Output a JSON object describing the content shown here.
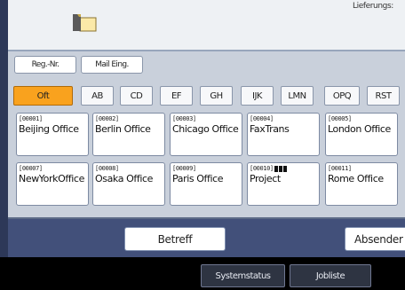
{
  "header": {
    "folder_label": "Lieferungs:"
  },
  "buttons": {
    "reg_nr": "Reg.-Nr.",
    "mail_eing": "Mail Eing."
  },
  "tabs": [
    "Oft",
    "AB",
    "CD",
    "EF",
    "GH",
    "IJK",
    "LMN",
    "OPQ",
    "RST"
  ],
  "active_tab": "Oft",
  "destinations": [
    {
      "number": "[00001]",
      "name": "Beijing Office"
    },
    {
      "number": "[00002]",
      "name": "Berlin Office"
    },
    {
      "number": "[00003]",
      "name": "Chicago Office"
    },
    {
      "number": "[00004]",
      "name": "FaxTrans"
    },
    {
      "number": "[00005]",
      "name": "London Office"
    },
    {
      "number": "[00007]",
      "name": "NewYorkOffice"
    },
    {
      "number": "[00008]",
      "name": "Osaka Office"
    },
    {
      "number": "[00009]",
      "name": "Paris Office"
    },
    {
      "number": "[00010]",
      "name": "Project",
      "group_icon": "group-icon"
    },
    {
      "number": "[00011]",
      "name": "Rome Office"
    }
  ],
  "actions": {
    "betreff": "Betreff",
    "absender": "Absender"
  },
  "status_bar": {
    "systemstatus": "Systemstatus",
    "jobliste": "Jobliste"
  },
  "colors": {
    "active_tab": "#f9a21e",
    "bottom_bar": "#42507a",
    "main_area": "#c9d0db"
  }
}
